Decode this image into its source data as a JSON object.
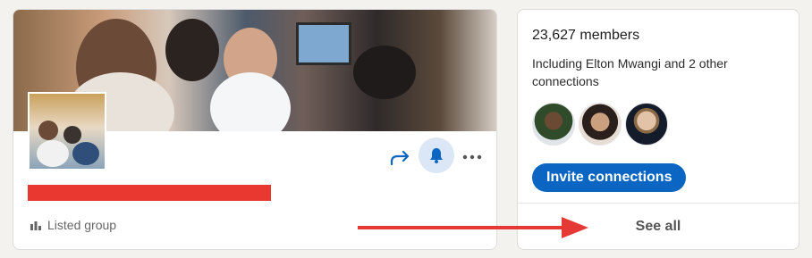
{
  "group": {
    "badge_label": "Listed group",
    "badge_icon": "chart-bars-icon",
    "actions": {
      "share_icon": "share-arrow-icon",
      "notify_icon": "bell-icon",
      "more_icon": "more-dots-icon"
    }
  },
  "members": {
    "count_text": "23,627 members",
    "connections_text": "Including Elton Mwangi and 2 other connections",
    "invite_label": "Invite connections",
    "see_all_label": "See all"
  },
  "colors": {
    "accent": "#0a66c2",
    "redaction": "#e8382f",
    "annotation_arrow": "#e53935",
    "bell_bg": "#dbe7f6"
  }
}
